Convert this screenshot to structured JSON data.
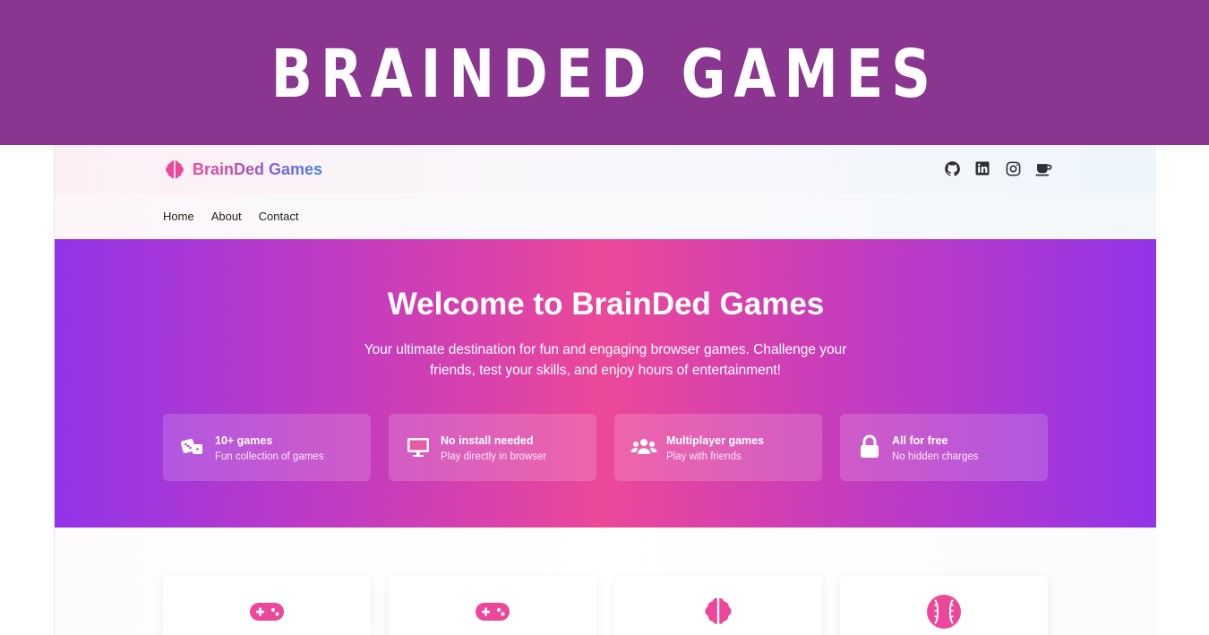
{
  "banner": {
    "title": "BRAINDED GAMES"
  },
  "header": {
    "brand_name": "BrainDed Games",
    "brand_icon": "brain-icon",
    "socials": [
      {
        "name": "github-icon"
      },
      {
        "name": "linkedin-icon"
      },
      {
        "name": "instagram-icon"
      },
      {
        "name": "coffee-icon"
      }
    ]
  },
  "nav": {
    "items": [
      "Home",
      "About",
      "Contact"
    ]
  },
  "hero": {
    "title": "Welcome to BrainDed Games",
    "subtitle": "Your ultimate destination for fun and engaging browser games. Challenge your friends, test your skills, and enjoy hours of entertainment!",
    "features": [
      {
        "icon": "dice-icon",
        "title": "10+ games",
        "desc": "Fun collection of games"
      },
      {
        "icon": "monitor-icon",
        "title": "No install needed",
        "desc": "Play directly in browser"
      },
      {
        "icon": "users-icon",
        "title": "Multiplayer games",
        "desc": "Play with friends"
      },
      {
        "icon": "lock-icon",
        "title": "All for free",
        "desc": "No hidden charges"
      }
    ]
  },
  "game_cards": [
    {
      "icon": "gamepad-icon"
    },
    {
      "icon": "gamepad-icon"
    },
    {
      "icon": "brain-icon"
    },
    {
      "icon": "baseball-icon"
    }
  ],
  "colors": {
    "banner_bg": "#8a3590",
    "accent_pink": "#ec4899",
    "accent_purple": "#9334e9",
    "accent_blue": "#3b82f6"
  }
}
